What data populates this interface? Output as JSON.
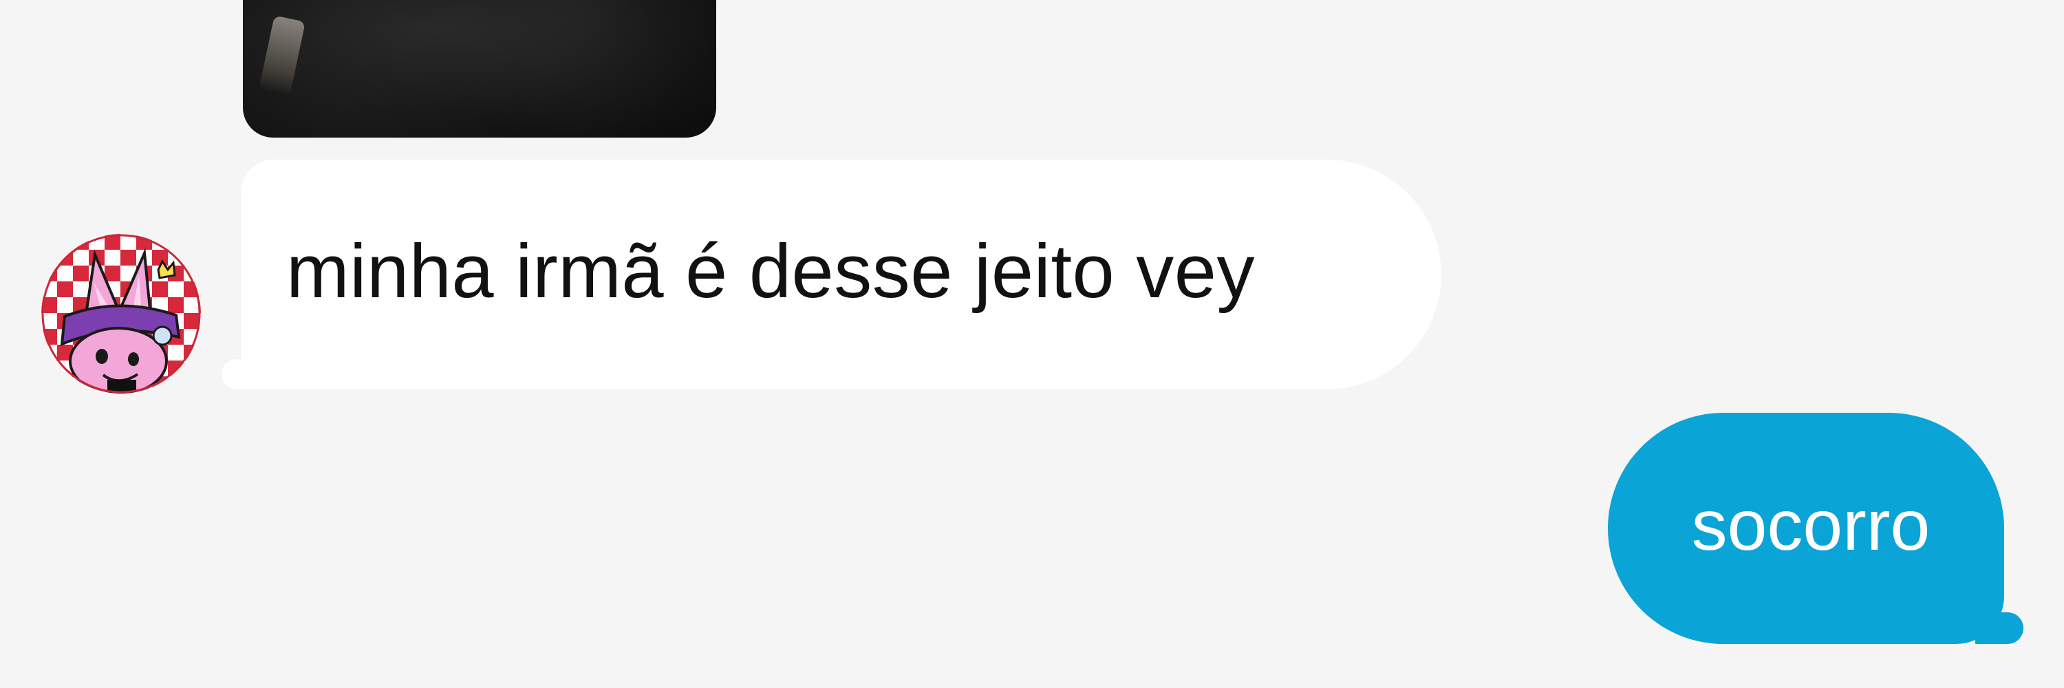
{
  "conversation": {
    "messages": [
      {
        "sender": "other",
        "type": "image",
        "avatar_icon": "profile-avatar-icon"
      },
      {
        "sender": "other",
        "type": "text",
        "text": "minha irmã é desse jeito vey"
      },
      {
        "sender": "me",
        "type": "text",
        "text": "socorro"
      }
    ]
  },
  "colors": {
    "background": "#f5f5f5",
    "received_bubble": "#ffffff",
    "sent_bubble": "#0aa4d6",
    "received_text": "#111111",
    "sent_text": "#ffffff"
  }
}
